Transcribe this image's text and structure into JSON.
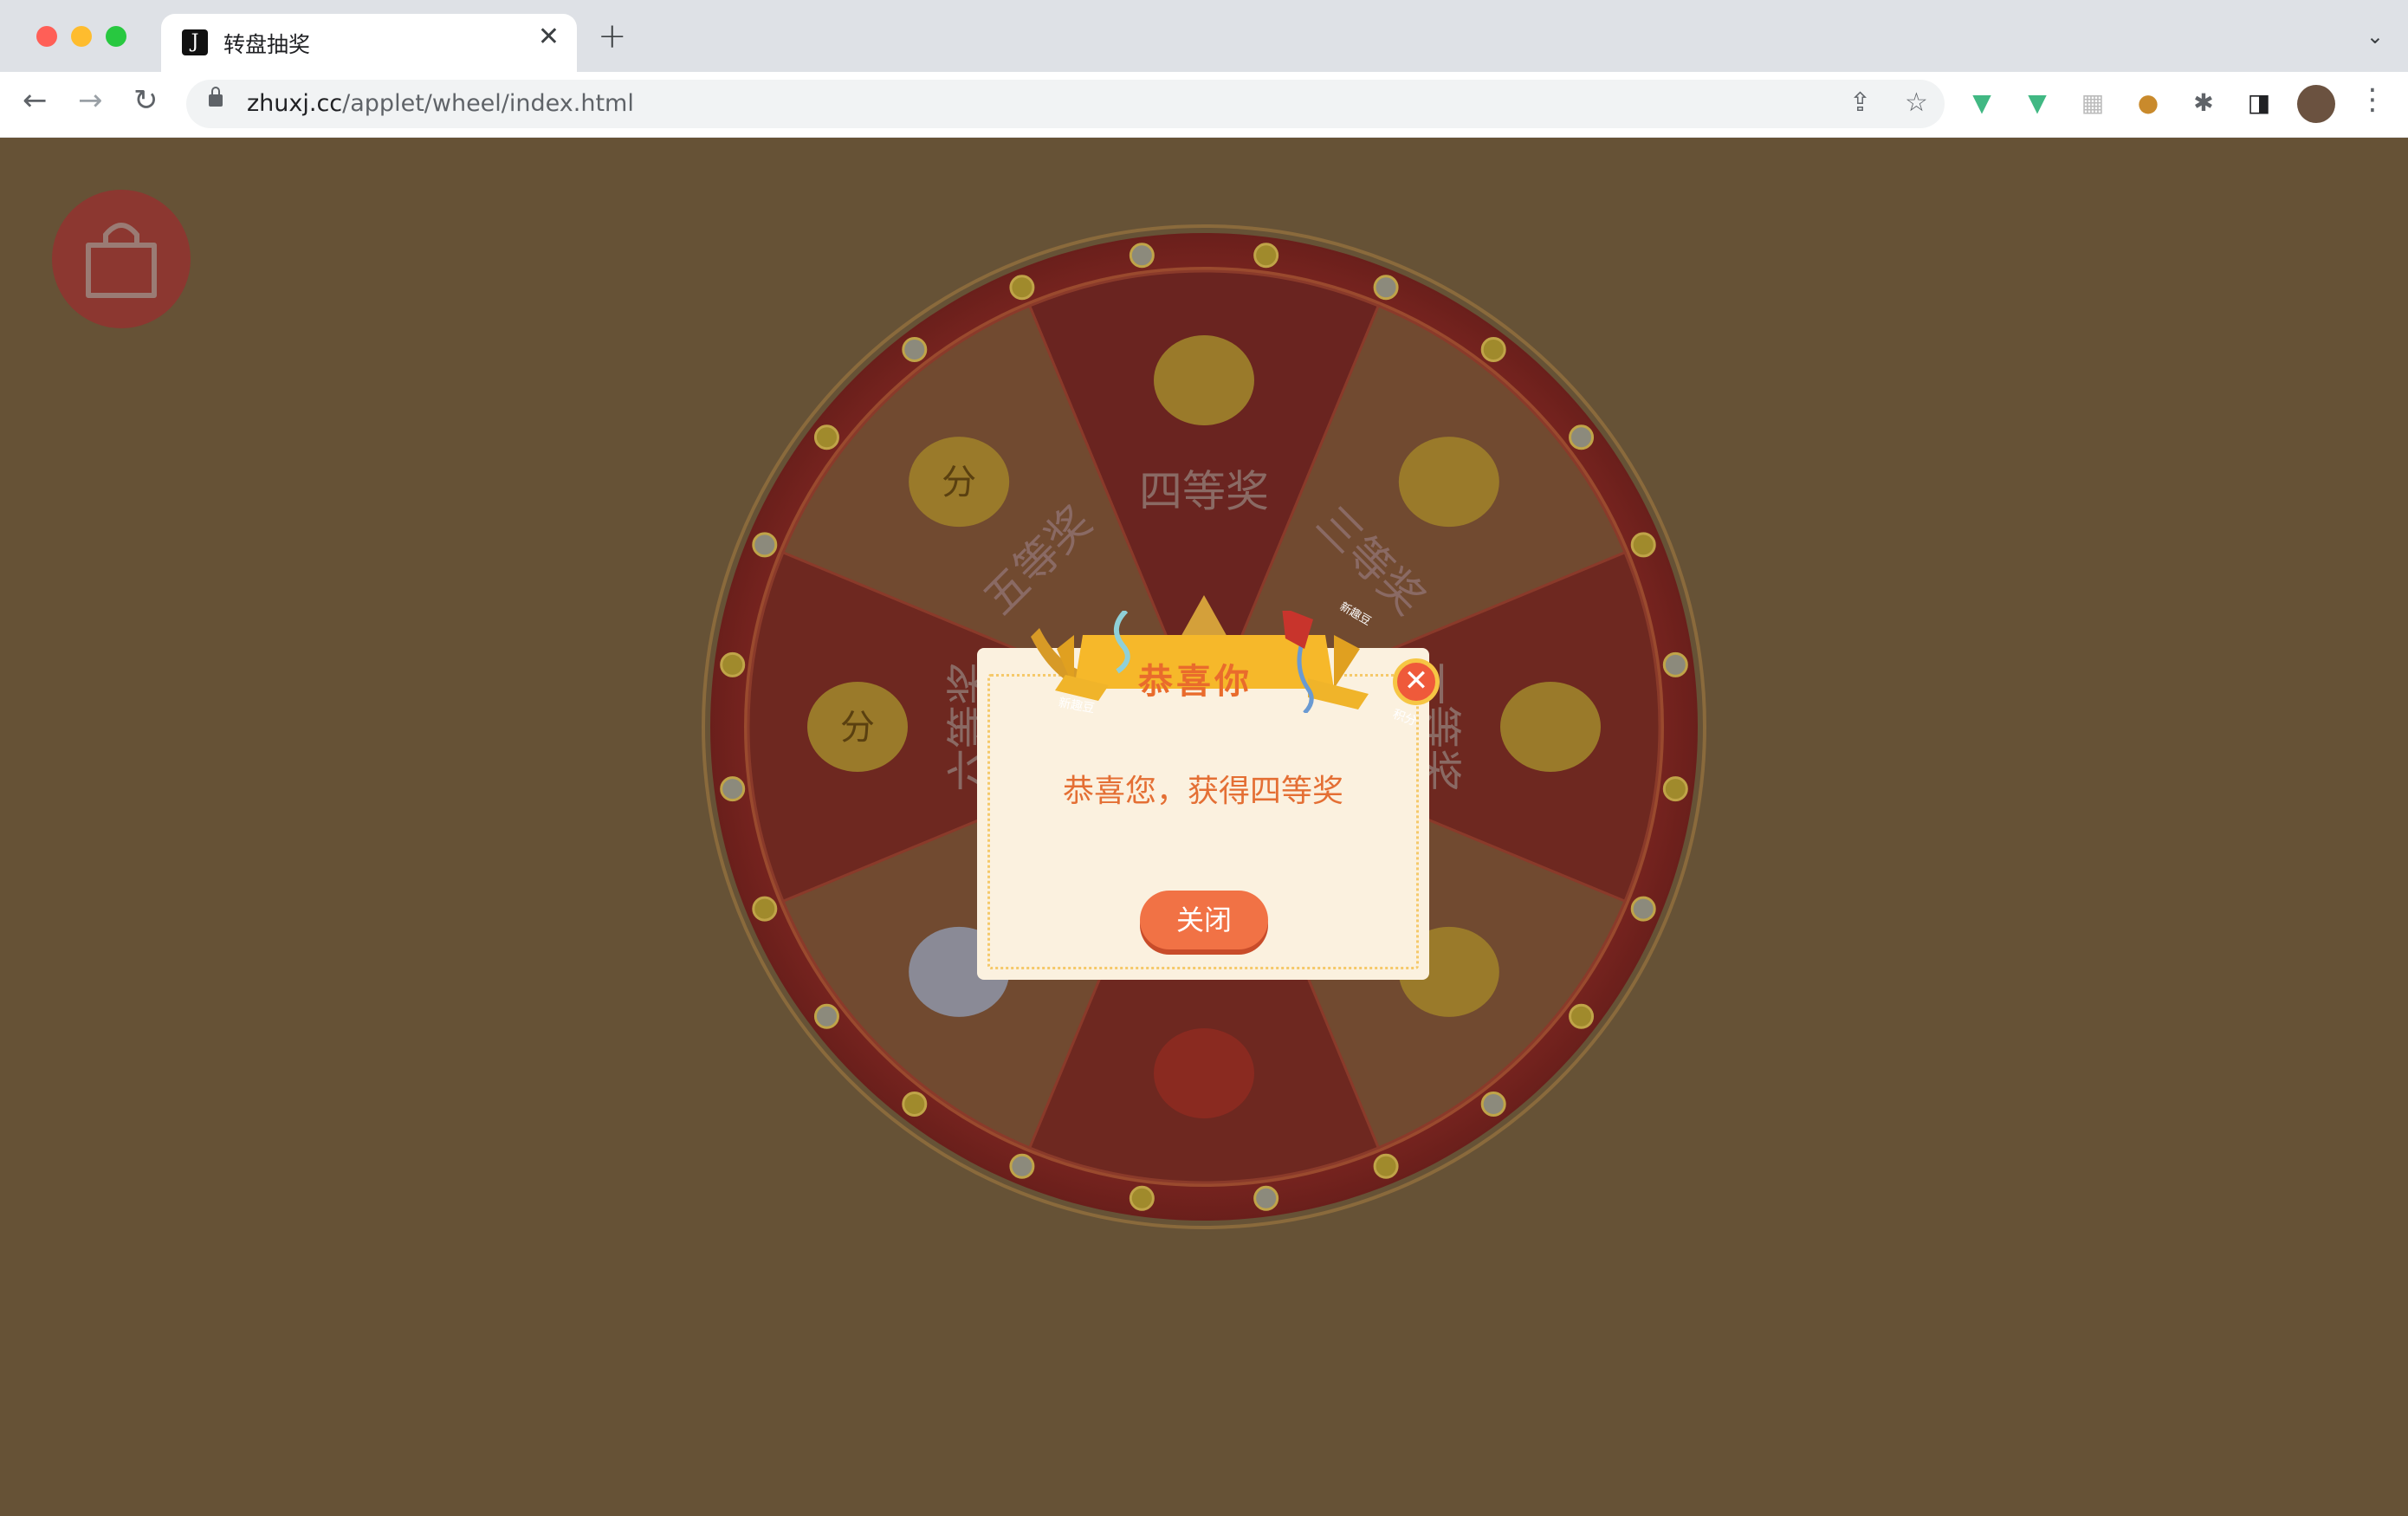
{
  "browser": {
    "tab_title": "转盘抽奖",
    "tab_favicon_letter": "J",
    "url_host": "zhuxj.cc",
    "url_path": "/applet/wheel/index.html",
    "traffic_colors": [
      "#ff5f57",
      "#febc2e",
      "#28c840"
    ]
  },
  "wheel": {
    "prizes": [
      {
        "label": "四等奖",
        "icon": "bean-icon"
      },
      {
        "label": "三等奖",
        "icon": "two-beans-icon"
      },
      {
        "label": "一等奖",
        "icon": "bean-pile-icon"
      },
      {
        "label": "",
        "icon": "many-beans-icon"
      },
      {
        "label": "",
        "icon": "lucky-bag-icon"
      },
      {
        "label": "",
        "icon": "cat-icon"
      },
      {
        "label": "六等奖",
        "icon": "coin-icon"
      },
      {
        "label": "五等奖",
        "icon": "two-coins-icon"
      }
    ],
    "coin_glyph": "分"
  },
  "modal": {
    "title": "恭喜你",
    "message": "恭喜您，获得四等奖",
    "close_label": "关闭",
    "close_icon": "✕",
    "tag_left": "新趣豆",
    "tag_right": "新趣豆",
    "tag_small": "积分"
  },
  "colors": {
    "page_bg": "#665236",
    "wheel_rim": "#8c2a24",
    "modal_bg": "#fbf1df",
    "ribbon": "#f6b82a",
    "accent": "#f17245"
  }
}
